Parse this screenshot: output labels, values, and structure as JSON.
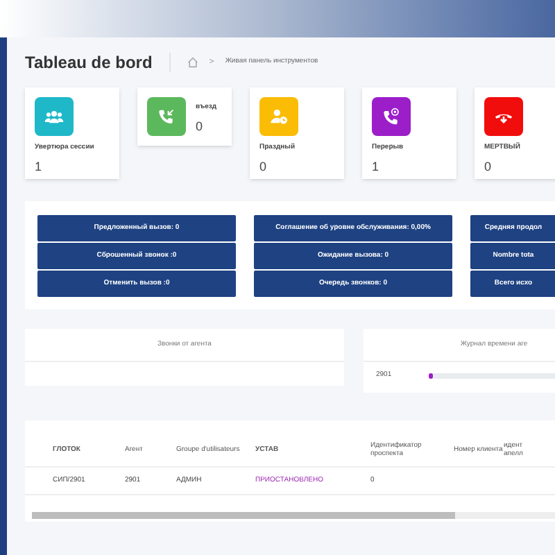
{
  "page_title": "Tableau de bord",
  "breadcrumb": {
    "separator": ">",
    "current": "Живая панель инструментов"
  },
  "stat_cards": [
    {
      "kind": "stacked",
      "label": "Увертюра сессии",
      "value": "1",
      "color": "#1fb8c9"
    },
    {
      "kind": "inline",
      "label": "въезд",
      "value": "0",
      "color": "#5cb85c"
    },
    {
      "kind": "stacked",
      "label": "Праздный",
      "value": "0",
      "color": "#fbbc05"
    },
    {
      "kind": "stacked",
      "label": "Перерыв",
      "value": "1",
      "color": "#9c1ec9"
    },
    {
      "kind": "stacked",
      "label": "МЕРТВЫЙ",
      "value": "0",
      "color": "#f20d0d"
    }
  ],
  "metric_buttons": [
    [
      "Предложенный вызов: 0",
      "Сброшенный звонок :0",
      "Отменить вызов :0"
    ],
    [
      "Соглашение об уровне обслуживания: 0,00%",
      "Ожидание вызова: 0",
      "Очередь звонков: 0"
    ],
    [
      "Средняя продол",
      "Nombre tota",
      "Всего исхо"
    ]
  ],
  "agent_calls": {
    "title": "Звонки от агента"
  },
  "agent_time_log": {
    "title": "Журнал времени аге",
    "rows": [
      {
        "label": "2901",
        "level": 0.02
      }
    ]
  },
  "table": {
    "columns": [
      "ГЛОТОК",
      "Агент",
      "Groupe d'utilisateurs",
      "УСТАВ",
      "Идентификатор проспекта",
      "Номер клиента",
      "идент апелл"
    ],
    "rows": [
      {
        "cells": [
          "СИП/2901",
          "2901",
          "АДМИН",
          "ПРИОСТАНОВЛЕНО",
          "0"
        ]
      }
    ]
  }
}
